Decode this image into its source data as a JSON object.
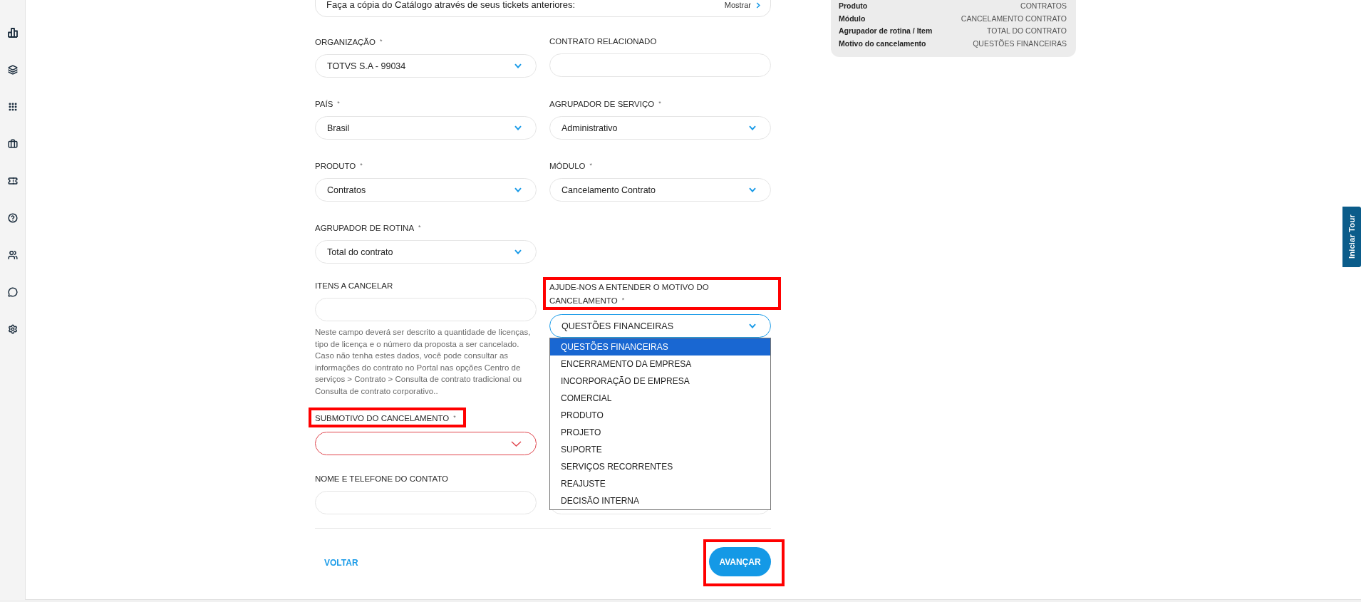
{
  "catalog_banner": {
    "text": "Faça a cópia do Catálogo através de seus tickets anteriores:",
    "action": "Mostrar"
  },
  "summary": {
    "rows": [
      {
        "label": "Produto",
        "value": "CONTRATOS"
      },
      {
        "label": "Módulo",
        "value": "CANCELAMENTO CONTRATO"
      },
      {
        "label": "Agrupador de rotina / Item",
        "value": "TOTAL DO CONTRATO"
      },
      {
        "label": "Motivo do cancelamento",
        "value": "QUESTÕES FINANCEIRAS"
      }
    ]
  },
  "form": {
    "fields": [
      {
        "kind": "select",
        "label": "ORGANIZAÇÃO",
        "required_mark": "*",
        "value": "TOTVS S.A - 99034",
        "invalid": false,
        "expanded": false,
        "highlighted": false
      },
      {
        "kind": "input",
        "label": "CONTRATO RELACIONADO",
        "invalid": false,
        "highlighted": false
      },
      {
        "kind": "select",
        "label": "PAÍS",
        "required_mark": "*",
        "value": "Brasil",
        "invalid": false,
        "expanded": false,
        "highlighted": false
      },
      {
        "kind": "select",
        "label": "AGRUPADOR DE SERVIÇO",
        "required_mark": "*",
        "value": "Administrativo",
        "invalid": false,
        "expanded": false,
        "highlighted": false
      },
      {
        "kind": "select",
        "label": "PRODUTO",
        "required_mark": "*",
        "value": "Contratos",
        "invalid": false,
        "expanded": false,
        "highlighted": false
      },
      {
        "kind": "select",
        "label": "MÓDULO",
        "required_mark": "*",
        "value": "Cancelamento Contrato",
        "invalid": false,
        "expanded": false,
        "highlighted": false
      },
      {
        "kind": "select",
        "label": "AGRUPADOR DE ROTINA",
        "required_mark": "*",
        "value": "Total do contrato",
        "invalid": false,
        "expanded": false,
        "highlighted": false
      }
    ],
    "details": {
      "left": [
        {
          "kind": "input",
          "label": "ITENS A CANCELAR",
          "help": "Neste campo deverá ser descrito a quantidade de licenças, tipo de licença e o número da proposta a ser cancelado. Caso não tenha estes dados, você pode consultar as informações do contrato no Portal nas opções Centro de serviços > Contrato > Consulta de contrato tradicional ou Consulta de contrato corporativo..",
          "invalid": false,
          "highlighted": false
        },
        {
          "kind": "select",
          "label": "SUBMOTIVO DO CANCELAMENTO",
          "required_mark": "*",
          "invalid": true,
          "expanded": false,
          "highlighted": true
        },
        {
          "kind": "input",
          "label": "NOME E TELEFONE DO CONTATO",
          "invalid": false,
          "highlighted": false
        }
      ],
      "right": [
        {
          "kind": "select",
          "label": "AJUDE-NOS A ENTENDER O MOTIVO DO CANCELAMENTO",
          "required_mark": "*",
          "value": "QUESTÕES FINANCEIRAS",
          "invalid": false,
          "expanded": true,
          "highlighted": true,
          "options": [
            {
              "label": "QUESTÕES FINANCEIRAS",
              "selected": true
            },
            {
              "label": "ENCERRAMENTO DA EMPRESA",
              "selected": false
            },
            {
              "label": "INCORPORAÇÃO DE EMPRESA",
              "selected": false
            },
            {
              "label": "COMERCIAL",
              "selected": false
            },
            {
              "label": "PRODUTO",
              "selected": false
            },
            {
              "label": "PROJETO",
              "selected": false
            },
            {
              "label": "SUPORTE",
              "selected": false
            },
            {
              "label": "SERVIÇOS RECORRENTES",
              "selected": false
            },
            {
              "label": "REAJUSTE",
              "selected": false
            },
            {
              "label": "DECISÃO INTERNA",
              "selected": false
            }
          ]
        },
        {
          "kind": "input",
          "invalid": false,
          "highlighted": false
        }
      ]
    }
  },
  "actions": {
    "back": {
      "label": "VOLTAR"
    },
    "next": {
      "label": "AVANÇAR",
      "highlighted": true
    }
  },
  "tour_tab": {
    "label": "Iniciar Tour"
  }
}
